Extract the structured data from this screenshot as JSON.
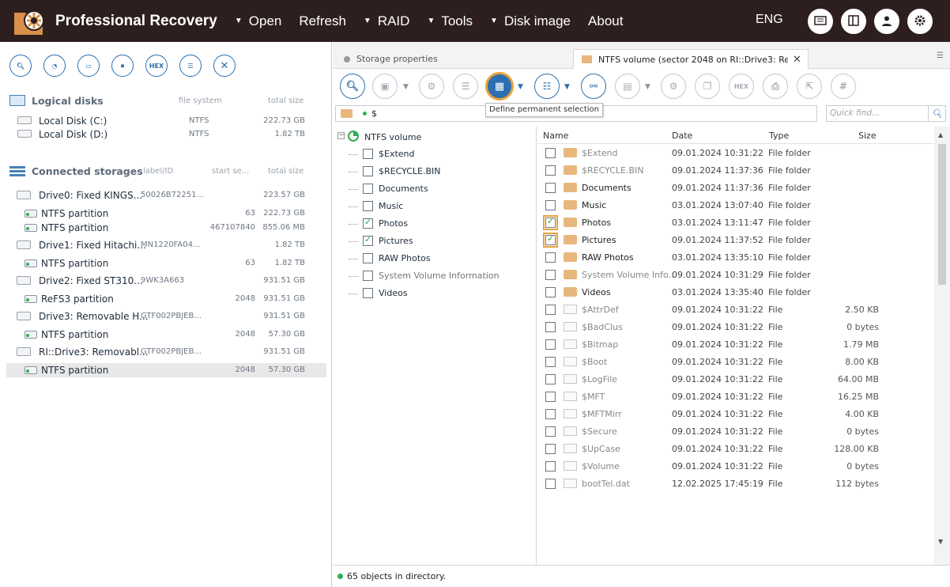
{
  "app": {
    "title": "Professional Recovery",
    "lang": "ENG"
  },
  "menu": [
    {
      "label": "Open",
      "caret": true
    },
    {
      "label": "Refresh",
      "caret": false
    },
    {
      "label": "RAID",
      "caret": true
    },
    {
      "label": "Tools",
      "caret": true
    },
    {
      "label": "Disk image",
      "caret": true
    },
    {
      "label": "About",
      "caret": false
    }
  ],
  "left": {
    "toolbar_hex": "HEX",
    "logical": {
      "title": "Logical disks",
      "col_fs": "file system",
      "col_size": "total size",
      "items": [
        {
          "name": "Local Disk (C:)",
          "fs": "NTFS",
          "size": "222.73 GB"
        },
        {
          "name": "Local Disk (D:)",
          "fs": "NTFS",
          "size": "1.82 TB"
        }
      ]
    },
    "storages": {
      "title": "Connected storages",
      "col_label": "label/ID",
      "col_start": "start se...",
      "col_size": "total size",
      "items": [
        {
          "name": "Drive0: Fixed KINGS...",
          "label": "50026B72251...",
          "start": "",
          "size": "223.57 GB",
          "kind": "disk"
        },
        {
          "name": "NTFS partition",
          "label": "",
          "start": "63",
          "size": "222.73 GB",
          "kind": "part"
        },
        {
          "name": "NTFS partition",
          "label": "",
          "start": "467107840",
          "size": "855.06 MB",
          "kind": "part"
        },
        {
          "name": "Drive1: Fixed Hitachi...",
          "label": "MN1220FA04...",
          "start": "",
          "size": "1.82 TB",
          "kind": "disk"
        },
        {
          "name": "NTFS partition",
          "label": "",
          "start": "63",
          "size": "1.82 TB",
          "kind": "part"
        },
        {
          "name": "Drive2: Fixed ST310...",
          "label": "9WK3A663",
          "start": "",
          "size": "931.51 GB",
          "kind": "disk"
        },
        {
          "name": "ReFS3 partition",
          "label": "",
          "start": "2048",
          "size": "931.51 GB",
          "kind": "part"
        },
        {
          "name": "Drive3: Removable H...",
          "label": "GTF002PBJEB...",
          "start": "",
          "size": "931.51 GB",
          "kind": "disk"
        },
        {
          "name": "NTFS partition",
          "label": "",
          "start": "2048",
          "size": "57.30 GB",
          "kind": "part"
        },
        {
          "name": "RI::Drive3: Removabl...",
          "label": "GTF002PBJEB...",
          "start": "",
          "size": "931.51 GB",
          "kind": "disk"
        },
        {
          "name": "NTFS partition",
          "label": "",
          "start": "2048",
          "size": "57.30 GB",
          "kind": "part"
        }
      ]
    }
  },
  "tabs": [
    {
      "label": "Storage properties",
      "active": false
    },
    {
      "label": "NTFS volume (sector 2048 on RI::Drive3: Remo...",
      "active": true
    }
  ],
  "toolbar": {
    "hex_label": "HEX",
    "hash_label": "#",
    "tooltip": "Define permanent selection"
  },
  "path": {
    "value": "$"
  },
  "find": {
    "placeholder": "Quick find..."
  },
  "tree": {
    "root": "NTFS volume",
    "items": [
      {
        "label": "$Extend",
        "checked": false
      },
      {
        "label": "$RECYCLE.BIN",
        "checked": false
      },
      {
        "label": "Documents",
        "checked": false
      },
      {
        "label": "Music",
        "checked": false
      },
      {
        "label": "Photos",
        "checked": true
      },
      {
        "label": "Pictures",
        "checked": true
      },
      {
        "label": "RAW Photos",
        "checked": false
      },
      {
        "label": "System Volume Information",
        "checked": false
      },
      {
        "label": "Videos",
        "checked": false
      }
    ]
  },
  "list": {
    "headers": {
      "name": "Name",
      "date": "Date",
      "type": "Type",
      "size": "Size"
    },
    "rows": [
      {
        "name": "$Extend",
        "date": "09.01.2024 10:31:22",
        "type": "File folder",
        "size": "",
        "kind": "folder",
        "checked": false,
        "dim": true
      },
      {
        "name": "$RECYCLE.BIN",
        "date": "09.01.2024 11:37:36",
        "type": "File folder",
        "size": "",
        "kind": "folder",
        "checked": false,
        "dim": true
      },
      {
        "name": "Documents",
        "date": "09.01.2024 11:37:36",
        "type": "File folder",
        "size": "",
        "kind": "folder",
        "checked": false,
        "dim": false
      },
      {
        "name": "Music",
        "date": "03.01.2024 13:07:40",
        "type": "File folder",
        "size": "",
        "kind": "folder",
        "checked": false,
        "dim": false
      },
      {
        "name": "Photos",
        "date": "03.01.2024 13:11:47",
        "type": "File folder",
        "size": "",
        "kind": "folder",
        "checked": true,
        "dim": false
      },
      {
        "name": "Pictures",
        "date": "09.01.2024 11:37:52",
        "type": "File folder",
        "size": "",
        "kind": "folder",
        "checked": true,
        "dim": false
      },
      {
        "name": "RAW Photos",
        "date": "03.01.2024 13:35:10",
        "type": "File folder",
        "size": "",
        "kind": "folder",
        "checked": false,
        "dim": false
      },
      {
        "name": "System Volume Info...",
        "date": "09.01.2024 10:31:29",
        "type": "File folder",
        "size": "",
        "kind": "folder",
        "checked": false,
        "dim": true
      },
      {
        "name": "Videos",
        "date": "03.01.2024 13:35:40",
        "type": "File folder",
        "size": "",
        "kind": "folder",
        "checked": false,
        "dim": false
      },
      {
        "name": "$AttrDef",
        "date": "09.01.2024 10:31:22",
        "type": "File",
        "size": "2.50 KB",
        "kind": "file",
        "checked": false,
        "dim": true
      },
      {
        "name": "$BadClus",
        "date": "09.01.2024 10:31:22",
        "type": "File",
        "size": "0 bytes",
        "kind": "file",
        "checked": false,
        "dim": true
      },
      {
        "name": "$Bitmap",
        "date": "09.01.2024 10:31:22",
        "type": "File",
        "size": "1.79 MB",
        "kind": "file",
        "checked": false,
        "dim": true
      },
      {
        "name": "$Boot",
        "date": "09.01.2024 10:31:22",
        "type": "File",
        "size": "8.00 KB",
        "kind": "file",
        "checked": false,
        "dim": true
      },
      {
        "name": "$LogFile",
        "date": "09.01.2024 10:31:22",
        "type": "File",
        "size": "64.00 MB",
        "kind": "file",
        "checked": false,
        "dim": true
      },
      {
        "name": "$MFT",
        "date": "09.01.2024 10:31:22",
        "type": "File",
        "size": "16.25 MB",
        "kind": "file",
        "checked": false,
        "dim": true
      },
      {
        "name": "$MFTMirr",
        "date": "09.01.2024 10:31:22",
        "type": "File",
        "size": "4.00 KB",
        "kind": "file",
        "checked": false,
        "dim": true
      },
      {
        "name": "$Secure",
        "date": "09.01.2024 10:31:22",
        "type": "File",
        "size": "0 bytes",
        "kind": "file",
        "checked": false,
        "dim": true
      },
      {
        "name": "$UpCase",
        "date": "09.01.2024 10:31:22",
        "type": "File",
        "size": "128.00 KB",
        "kind": "file",
        "checked": false,
        "dim": true
      },
      {
        "name": "$Volume",
        "date": "09.01.2024 10:31:22",
        "type": "File",
        "size": "0 bytes",
        "kind": "file",
        "checked": false,
        "dim": true
      },
      {
        "name": "bootTel.dat",
        "date": "12.02.2025 17:45:19",
        "type": "File",
        "size": "112 bytes",
        "kind": "file",
        "checked": false,
        "dim": true
      }
    ]
  },
  "status": {
    "text": "65 objects in directory."
  }
}
